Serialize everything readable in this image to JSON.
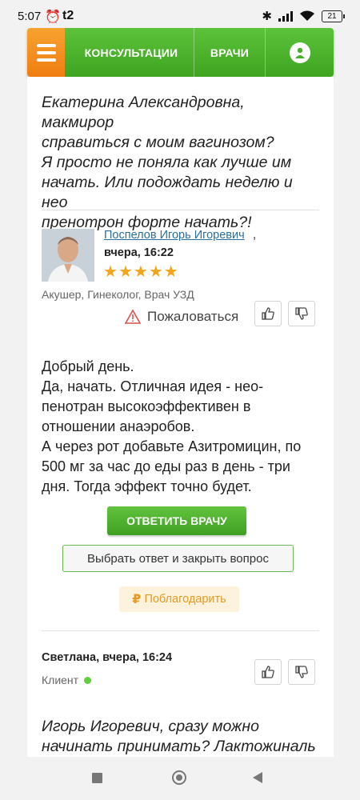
{
  "status_bar": {
    "time": "5:07",
    "carrier": "t2",
    "battery": "21"
  },
  "nav": {
    "tab_consultations": "КОНСУЛЬТАЦИИ",
    "tab_doctors": "ВРАЧИ"
  },
  "messages": {
    "question_lines": [
      "Екатерина Александровна, макмирор",
      "справиться с моим вагинозом?",
      "Я просто не поняла как лучше им",
      "начать. Или подождать неделю и нео",
      "пренотрон форте начать?!"
    ],
    "doctor": {
      "name": "Поспелов Игорь Игоревич",
      "date": "вчера, 16:22",
      "rating_stars": 5,
      "specialty": "Акушер, Гинеколог, Врач УЗД",
      "complain_label": "Пожаловаться",
      "answer_lines": [
        "Добрый день.",
        "Да, начать. Отличная идея - нео-",
        "пенотран высокоэффективен в",
        "отношении анаэробов.",
        "А через рот добавьте Азитромицин, по",
        "500 мг за час до еды раз в день - три",
        "дня. Тогда эффект точно будет."
      ]
    },
    "buttons": {
      "reply": "ОТВЕТИТЬ ВРАЧУ",
      "choose_answer": "Выбрать ответ и закрыть вопрос",
      "thank": "Поблагодарить"
    },
    "client": {
      "name_date": "Светлана, вчера, 16:24",
      "role": "Клиент",
      "message_lines": [
        "Игорь Игоревич, сразу можно",
        "начинать принимать? Лактожиналь"
      ]
    }
  },
  "colors": {
    "green": "#4caf2c",
    "orange": "#f39220",
    "link": "#2a6f9e",
    "star": "#f2a51b"
  }
}
